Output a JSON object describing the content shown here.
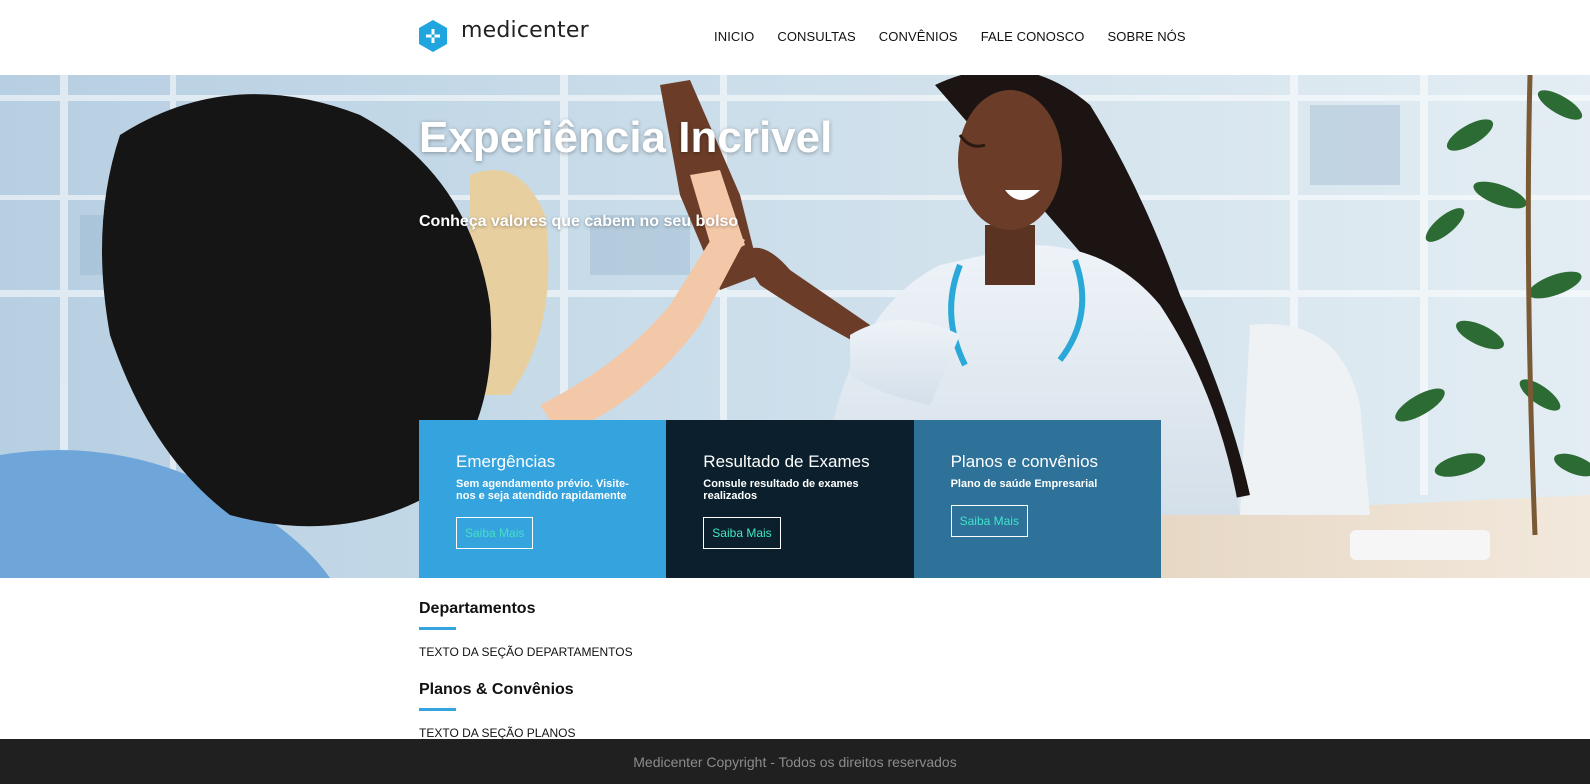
{
  "brand": {
    "name": "medicenter",
    "logo_icon": "hexagon-plus-icon",
    "accent_color": "#35a3dd"
  },
  "nav": {
    "items": [
      "INICIO",
      "CONSULTAS",
      "CONVÊNIOS",
      "FALE CONOSCO",
      "SOBRE NÓS"
    ]
  },
  "hero": {
    "title": "Experiência Incrivel",
    "subtitle": "Conheça valores que cabem no seu bolso"
  },
  "cards": [
    {
      "title": "Emergências",
      "text": "Sem agendamento prévio. Visite-nos e seja atendido rapidamente",
      "button": "Saiba Mais",
      "color": "#35a3dd"
    },
    {
      "title": "Resultado de Exames",
      "text": "Consule resultado de exames realizados",
      "button": "Saiba Mais",
      "color": "#0b1f2d"
    },
    {
      "title": "Planos e convênios",
      "text": "Plano de saúde Empresarial",
      "button": "Saiba Mais",
      "color": "#2e7199"
    }
  ],
  "sections": {
    "departamentos": {
      "title": "Departamentos",
      "text": "TEXTO DA SEÇÃO DEPARTAMENTOS"
    },
    "planos": {
      "title": "Planos & Convênios",
      "text": "TEXTO DA SEÇÃO PLANOS"
    }
  },
  "footer": {
    "text": "Medicenter Copyright - Todos os direitos reservados"
  }
}
